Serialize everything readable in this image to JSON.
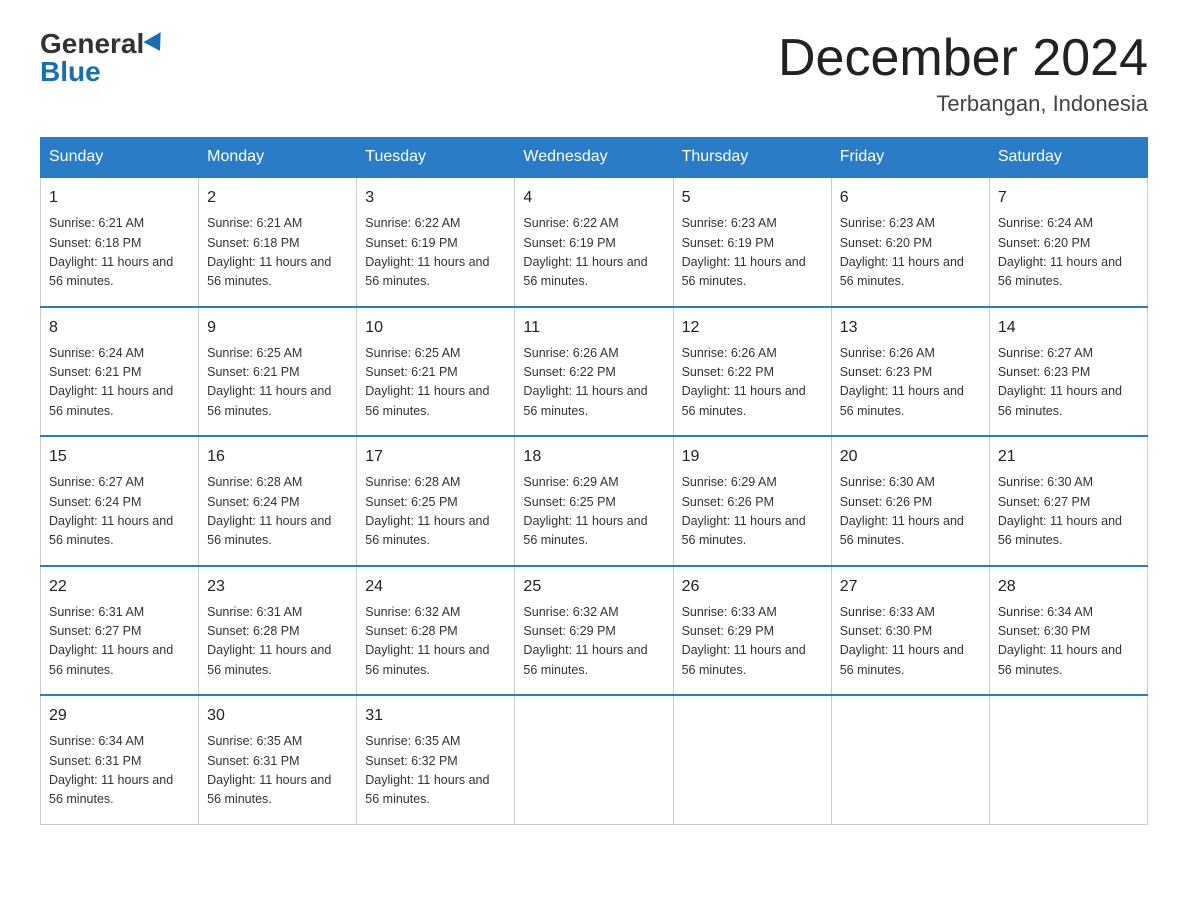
{
  "header": {
    "logo_general": "General",
    "logo_blue": "Blue",
    "title": "December 2024",
    "subtitle": "Terbangan, Indonesia"
  },
  "days": [
    "Sunday",
    "Monday",
    "Tuesday",
    "Wednesday",
    "Thursday",
    "Friday",
    "Saturday"
  ],
  "weeks": [
    [
      {
        "num": "1",
        "sunrise": "6:21 AM",
        "sunset": "6:18 PM",
        "daylight": "11 hours and 56 minutes."
      },
      {
        "num": "2",
        "sunrise": "6:21 AM",
        "sunset": "6:18 PM",
        "daylight": "11 hours and 56 minutes."
      },
      {
        "num": "3",
        "sunrise": "6:22 AM",
        "sunset": "6:19 PM",
        "daylight": "11 hours and 56 minutes."
      },
      {
        "num": "4",
        "sunrise": "6:22 AM",
        "sunset": "6:19 PM",
        "daylight": "11 hours and 56 minutes."
      },
      {
        "num": "5",
        "sunrise": "6:23 AM",
        "sunset": "6:19 PM",
        "daylight": "11 hours and 56 minutes."
      },
      {
        "num": "6",
        "sunrise": "6:23 AM",
        "sunset": "6:20 PM",
        "daylight": "11 hours and 56 minutes."
      },
      {
        "num": "7",
        "sunrise": "6:24 AM",
        "sunset": "6:20 PM",
        "daylight": "11 hours and 56 minutes."
      }
    ],
    [
      {
        "num": "8",
        "sunrise": "6:24 AM",
        "sunset": "6:21 PM",
        "daylight": "11 hours and 56 minutes."
      },
      {
        "num": "9",
        "sunrise": "6:25 AM",
        "sunset": "6:21 PM",
        "daylight": "11 hours and 56 minutes."
      },
      {
        "num": "10",
        "sunrise": "6:25 AM",
        "sunset": "6:21 PM",
        "daylight": "11 hours and 56 minutes."
      },
      {
        "num": "11",
        "sunrise": "6:26 AM",
        "sunset": "6:22 PM",
        "daylight": "11 hours and 56 minutes."
      },
      {
        "num": "12",
        "sunrise": "6:26 AM",
        "sunset": "6:22 PM",
        "daylight": "11 hours and 56 minutes."
      },
      {
        "num": "13",
        "sunrise": "6:26 AM",
        "sunset": "6:23 PM",
        "daylight": "11 hours and 56 minutes."
      },
      {
        "num": "14",
        "sunrise": "6:27 AM",
        "sunset": "6:23 PM",
        "daylight": "11 hours and 56 minutes."
      }
    ],
    [
      {
        "num": "15",
        "sunrise": "6:27 AM",
        "sunset": "6:24 PM",
        "daylight": "11 hours and 56 minutes."
      },
      {
        "num": "16",
        "sunrise": "6:28 AM",
        "sunset": "6:24 PM",
        "daylight": "11 hours and 56 minutes."
      },
      {
        "num": "17",
        "sunrise": "6:28 AM",
        "sunset": "6:25 PM",
        "daylight": "11 hours and 56 minutes."
      },
      {
        "num": "18",
        "sunrise": "6:29 AM",
        "sunset": "6:25 PM",
        "daylight": "11 hours and 56 minutes."
      },
      {
        "num": "19",
        "sunrise": "6:29 AM",
        "sunset": "6:26 PM",
        "daylight": "11 hours and 56 minutes."
      },
      {
        "num": "20",
        "sunrise": "6:30 AM",
        "sunset": "6:26 PM",
        "daylight": "11 hours and 56 minutes."
      },
      {
        "num": "21",
        "sunrise": "6:30 AM",
        "sunset": "6:27 PM",
        "daylight": "11 hours and 56 minutes."
      }
    ],
    [
      {
        "num": "22",
        "sunrise": "6:31 AM",
        "sunset": "6:27 PM",
        "daylight": "11 hours and 56 minutes."
      },
      {
        "num": "23",
        "sunrise": "6:31 AM",
        "sunset": "6:28 PM",
        "daylight": "11 hours and 56 minutes."
      },
      {
        "num": "24",
        "sunrise": "6:32 AM",
        "sunset": "6:28 PM",
        "daylight": "11 hours and 56 minutes."
      },
      {
        "num": "25",
        "sunrise": "6:32 AM",
        "sunset": "6:29 PM",
        "daylight": "11 hours and 56 minutes."
      },
      {
        "num": "26",
        "sunrise": "6:33 AM",
        "sunset": "6:29 PM",
        "daylight": "11 hours and 56 minutes."
      },
      {
        "num": "27",
        "sunrise": "6:33 AM",
        "sunset": "6:30 PM",
        "daylight": "11 hours and 56 minutes."
      },
      {
        "num": "28",
        "sunrise": "6:34 AM",
        "sunset": "6:30 PM",
        "daylight": "11 hours and 56 minutes."
      }
    ],
    [
      {
        "num": "29",
        "sunrise": "6:34 AM",
        "sunset": "6:31 PM",
        "daylight": "11 hours and 56 minutes."
      },
      {
        "num": "30",
        "sunrise": "6:35 AM",
        "sunset": "6:31 PM",
        "daylight": "11 hours and 56 minutes."
      },
      {
        "num": "31",
        "sunrise": "6:35 AM",
        "sunset": "6:32 PM",
        "daylight": "11 hours and 56 minutes."
      },
      null,
      null,
      null,
      null
    ]
  ]
}
